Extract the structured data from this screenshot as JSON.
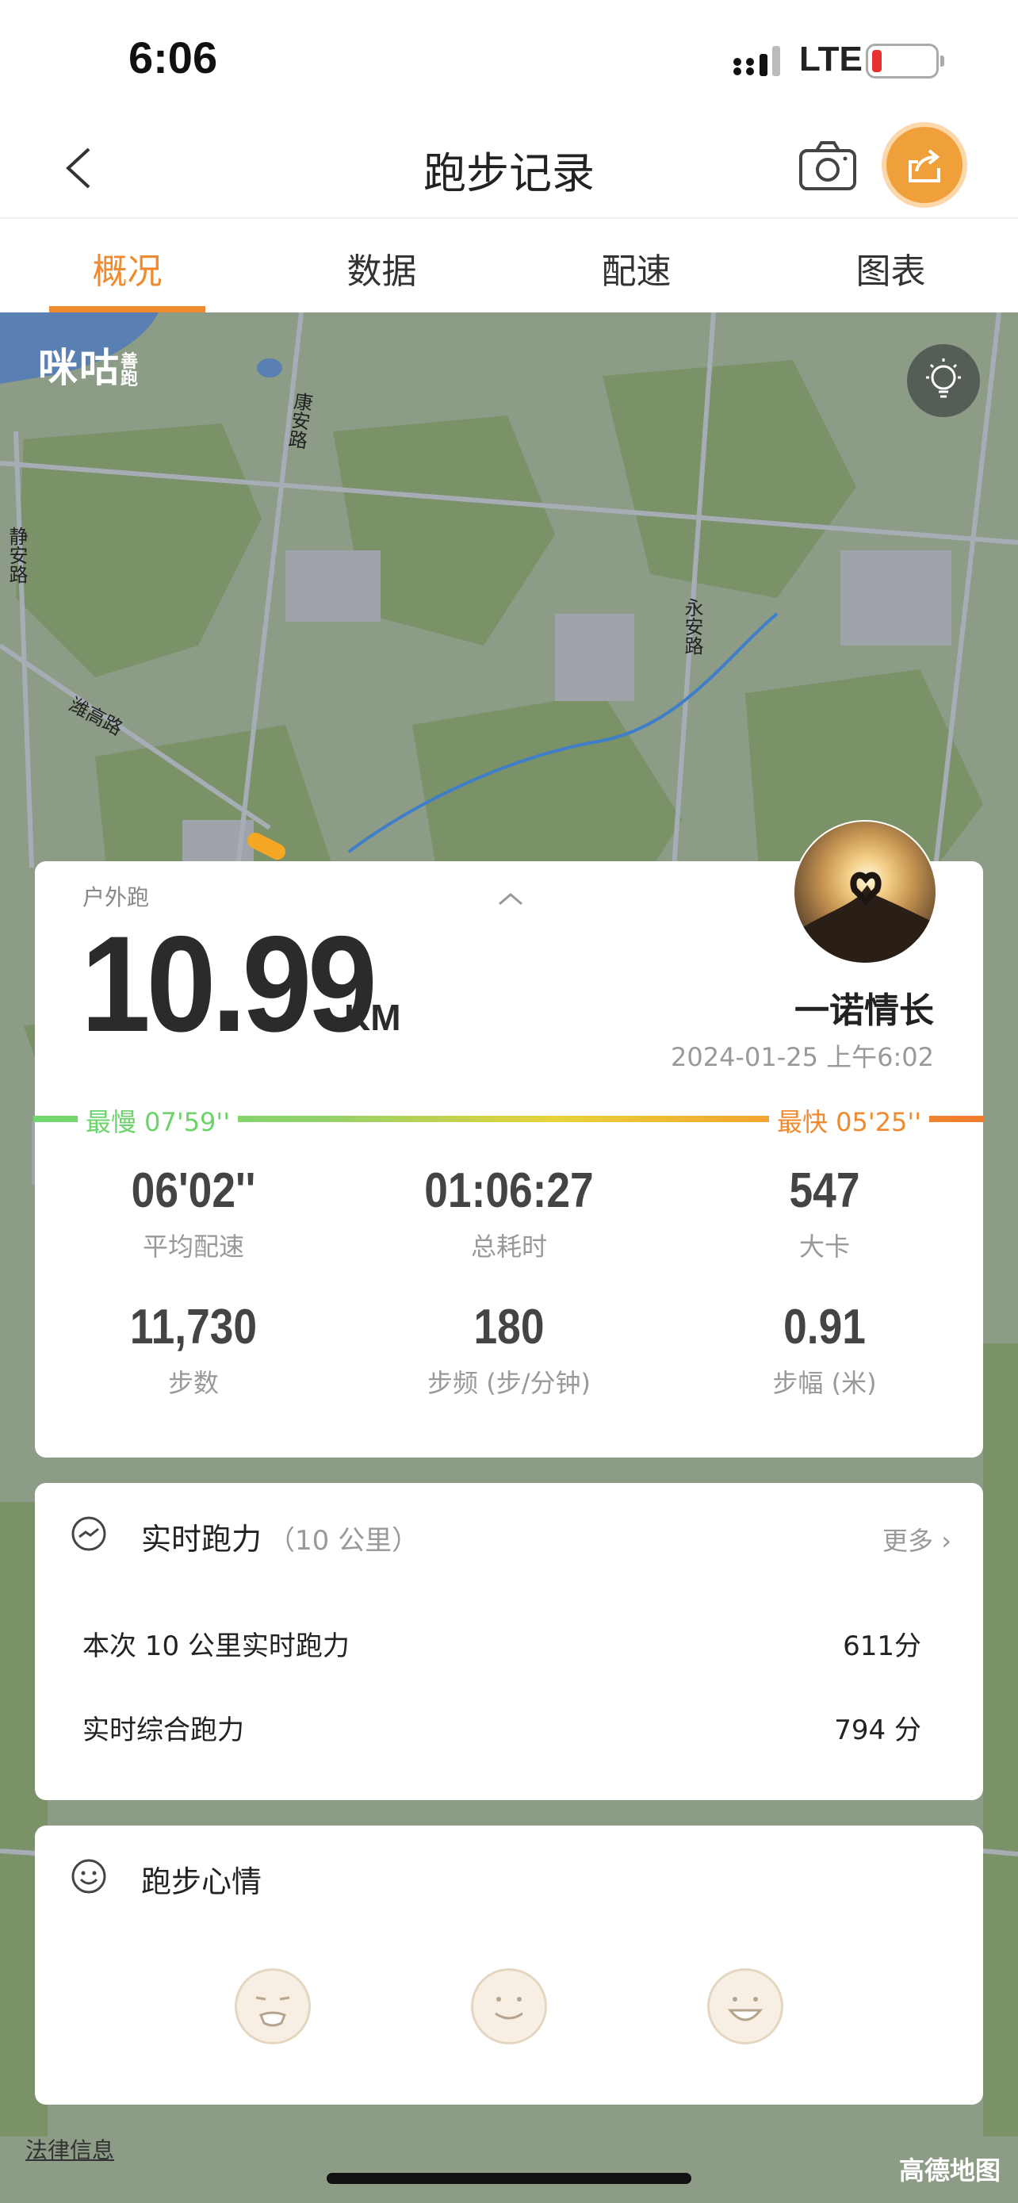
{
  "status_bar": {
    "time": "6:06",
    "network": "LTE"
  },
  "header": {
    "title": "跑步记录"
  },
  "tabs": [
    {
      "label": "概况",
      "active": true
    },
    {
      "label": "数据",
      "active": false
    },
    {
      "label": "配速",
      "active": false
    },
    {
      "label": "图表",
      "active": false
    }
  ],
  "map": {
    "logo": "咪咕",
    "logo_sub": "善跑",
    "roads": [
      "康安路",
      "静安路",
      "潍高路",
      "永安路"
    ],
    "legal_link": "法律信息",
    "provider": "高德地图"
  },
  "summary": {
    "run_type": "户外跑",
    "distance": "10.99",
    "distance_unit": "KM",
    "username": "一诺情长",
    "datetime": "2024-01-25 上午6:02",
    "slowest_label": "最慢  07'59''",
    "fastest_label": "最快  05'25''",
    "stats": [
      {
        "value": "06'02''",
        "label": "平均配速"
      },
      {
        "value": "01:06:27",
        "label": "总耗时"
      },
      {
        "value": "547",
        "label": "大卡"
      },
      {
        "value": "11,730",
        "label": "步数"
      },
      {
        "value": "180",
        "label": "步频 (步/分钟)"
      },
      {
        "value": "0.91",
        "label": "步幅 (米)"
      }
    ]
  },
  "running_power": {
    "title": "实时跑力",
    "subtitle": "（10 公里）",
    "more": "更多",
    "rows": [
      {
        "label": "本次 10 公里实时跑力",
        "value": "611分"
      },
      {
        "label": "实时综合跑力",
        "value": "794 分"
      }
    ]
  },
  "mood": {
    "title": "跑步心情"
  },
  "colors": {
    "accent": "#ef8a2e",
    "slow": "#6cd36a",
    "fast": "#ef8a2e",
    "map_bg": "#8a9a84"
  }
}
